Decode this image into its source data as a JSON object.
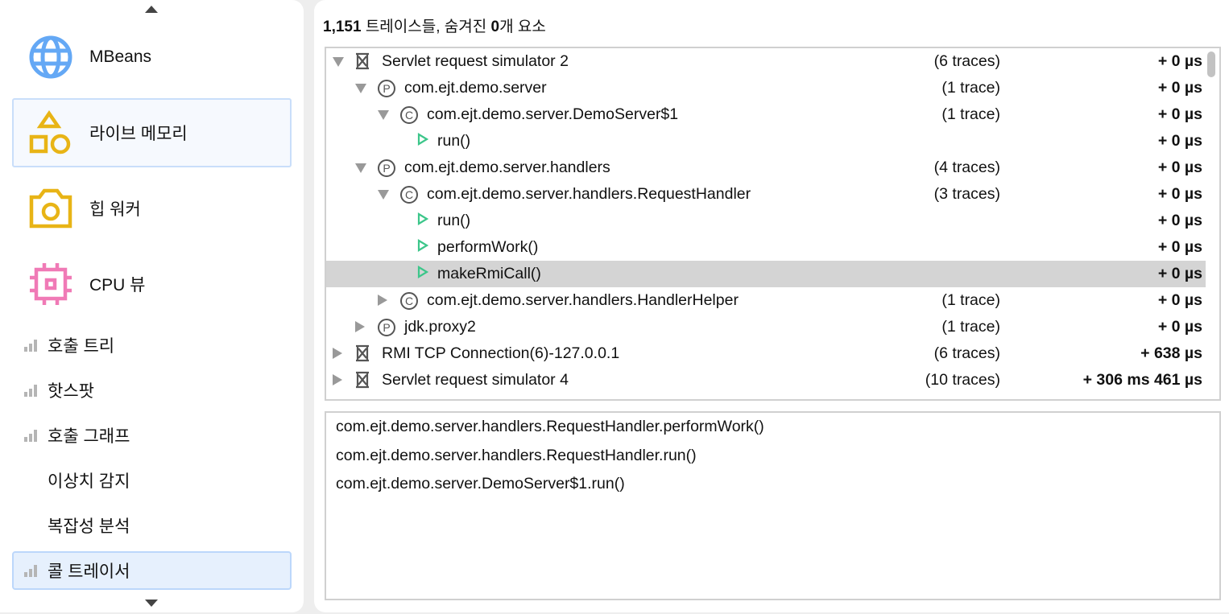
{
  "sidebar": {
    "big_items": [
      {
        "label": "MBeans",
        "icon": "globe-icon"
      },
      {
        "label": "라이브 메모리",
        "icon": "shapes-icon"
      },
      {
        "label": "힙 워커",
        "icon": "camera-icon"
      },
      {
        "label": "CPU 뷰",
        "icon": "cpu-icon"
      }
    ],
    "small_items": [
      {
        "label": "호출 트리"
      },
      {
        "label": "핫스팟"
      },
      {
        "label": "호출 그래프"
      },
      {
        "label": "이상치 감지"
      },
      {
        "label": "복잡성 분석"
      },
      {
        "label": "콜 트레이서"
      }
    ]
  },
  "header": {
    "count": "1,151",
    "text1": " 트레이스들, 숨겨진 ",
    "hidden": "0",
    "text2": "개 요소"
  },
  "tree": [
    {
      "label": "Servlet request simulator 2",
      "count": "(6 traces)",
      "time": "+ 0 µs",
      "level": 0,
      "type": "thread",
      "open": true
    },
    {
      "label": "com.ejt.demo.server",
      "count": "(1 trace)",
      "time": "+ 0 µs",
      "level": 1,
      "type": "package",
      "open": true
    },
    {
      "label": "com.ejt.demo.server.DemoServer$1",
      "count": "(1 trace)",
      "time": "+ 0 µs",
      "level": 2,
      "type": "class",
      "open": true
    },
    {
      "label": "run()",
      "count": "",
      "time": "+ 0 µs",
      "level": 3,
      "type": "method"
    },
    {
      "label": "com.ejt.demo.server.handlers",
      "count": "(4 traces)",
      "time": "+ 0 µs",
      "level": 1,
      "type": "package",
      "open": true
    },
    {
      "label": "com.ejt.demo.server.handlers.RequestHandler",
      "count": "(3 traces)",
      "time": "+ 0 µs",
      "level": 2,
      "type": "class",
      "open": true
    },
    {
      "label": "run()",
      "count": "",
      "time": "+ 0 µs",
      "level": 3,
      "type": "method"
    },
    {
      "label": "performWork()",
      "count": "",
      "time": "+ 0 µs",
      "level": 3,
      "type": "method"
    },
    {
      "label": "makeRmiCall()",
      "count": "",
      "time": "+ 0 µs",
      "level": 3,
      "type": "method",
      "selected": true
    },
    {
      "label": "com.ejt.demo.server.handlers.HandlerHelper",
      "count": "(1 trace)",
      "time": "+ 0 µs",
      "level": 2,
      "type": "class",
      "open": false
    },
    {
      "label": "jdk.proxy2",
      "count": "(1 trace)",
      "time": "+ 0 µs",
      "level": 1,
      "type": "package",
      "open": false
    },
    {
      "label": "RMI TCP Connection(6)-127.0.0.1",
      "count": "(6 traces)",
      "time": "+ 638 µs",
      "level": 0,
      "type": "thread",
      "open": false
    },
    {
      "label": "Servlet request simulator 4",
      "count": "(10 traces)",
      "time": "+ 306 ms 461 µs",
      "level": 0,
      "type": "thread",
      "open": false
    }
  ],
  "stack": [
    "com.ejt.demo.server.handlers.RequestHandler.performWork()",
    "com.ejt.demo.server.handlers.RequestHandler.run()",
    "com.ejt.demo.server.DemoServer$1.run()"
  ]
}
